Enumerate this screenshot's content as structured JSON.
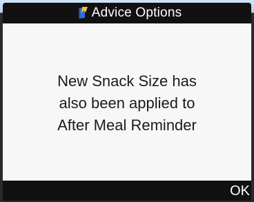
{
  "header": {
    "title": "Advice Options",
    "icon": "book-bookmark-icon",
    "icon_colors": {
      "cover": "#2f6fd6",
      "bookmark": "#f2c230"
    }
  },
  "message": {
    "lines": [
      "New Snack Size has",
      "also been applied to",
      "After Meal Reminder"
    ]
  },
  "footer": {
    "ok_label": "OK"
  },
  "colors": {
    "bar_background": "#111111",
    "screen_background": "#f7f7f7",
    "text": "#1b1b1b"
  }
}
